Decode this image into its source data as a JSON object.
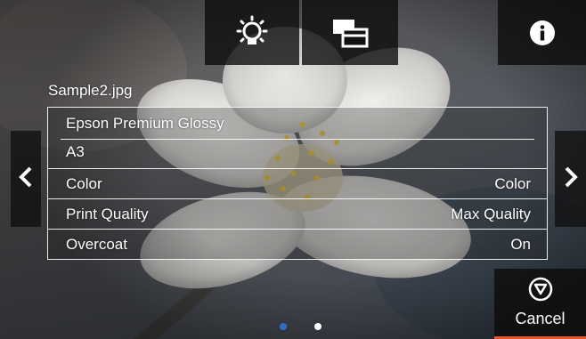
{
  "toolbar": {
    "buttons": [
      {
        "icon": "light-bulb-icon"
      },
      {
        "icon": "layers-icon"
      },
      {
        "icon": "info-icon"
      }
    ]
  },
  "preview": {
    "filename": "Sample2.jpg"
  },
  "settings": {
    "rows": [
      {
        "label": "Epson Premium Glossy",
        "value": ""
      },
      {
        "label": "A3",
        "value": ""
      },
      {
        "label": "Color",
        "value": "Color"
      },
      {
        "label": "Print Quality",
        "value": "Max Quality"
      },
      {
        "label": "Overcoat",
        "value": "On"
      }
    ]
  },
  "navigation": {
    "prev_icon": "chevron-left-icon",
    "next_icon": "chevron-right-icon"
  },
  "cancel": {
    "label": "Cancel",
    "icon": "stop-icon",
    "accent_color": "#e8562a"
  },
  "pagination": {
    "page_count": 2,
    "current_page": 1,
    "active_color": "#2f6fc8",
    "inactive_color": "#ffffff"
  }
}
